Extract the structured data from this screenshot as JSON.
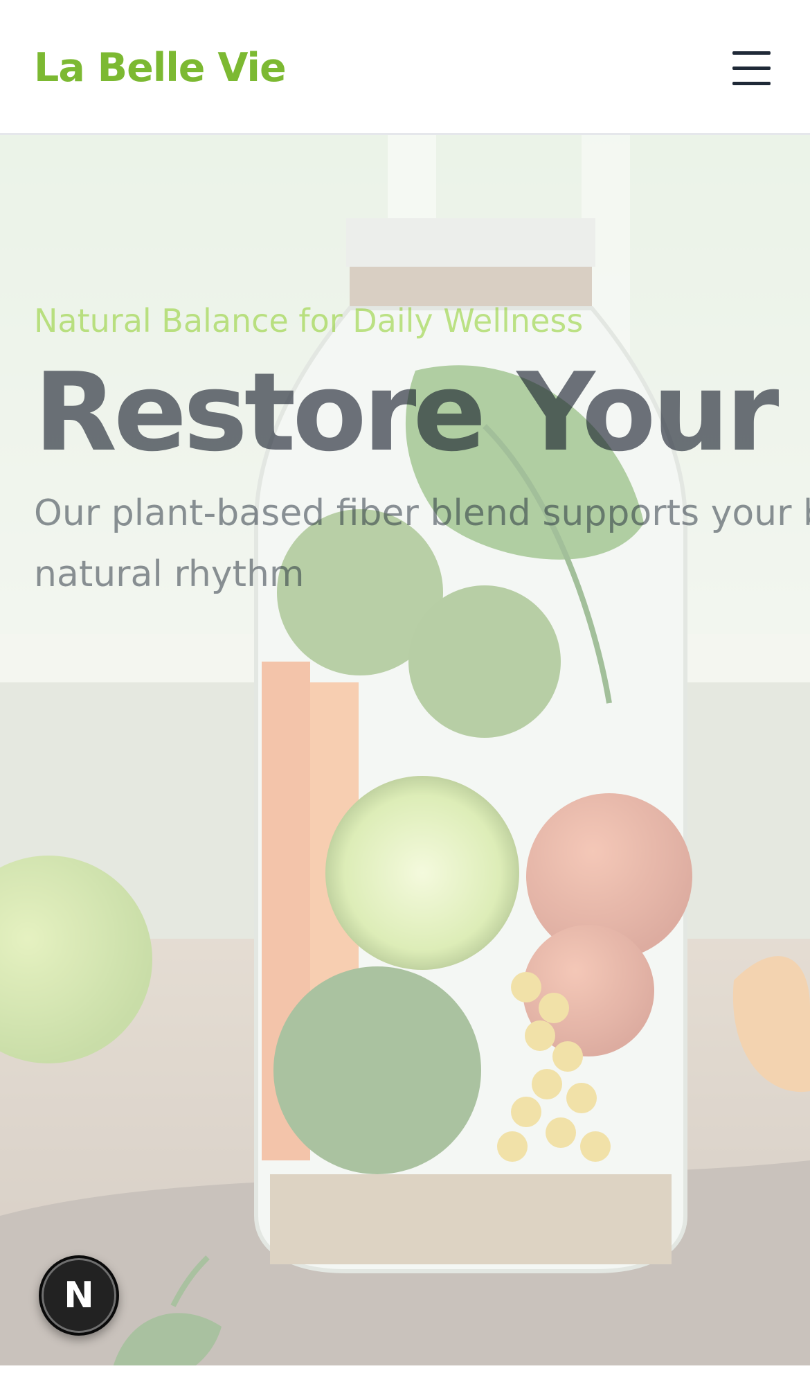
{
  "header": {
    "brand": "La Belle Vie",
    "menu_icon": "hamburger-menu-icon"
  },
  "hero": {
    "eyebrow": "Natural Balance for Daily Wellness",
    "headline": "Restore Your Body",
    "subcopy_line1": "Our plant-based fiber blend supports your body's",
    "subcopy_line2": "natural rhythm",
    "image_subject": "glass jar filled with vegetables on a table"
  },
  "floating_badge": {
    "letter": "N",
    "icon": "dev-tools-n-icon"
  },
  "colors": {
    "brand": "#7cb932",
    "heading": "#111827",
    "body": "#1f2937",
    "eyebrow": "#84cc16"
  }
}
